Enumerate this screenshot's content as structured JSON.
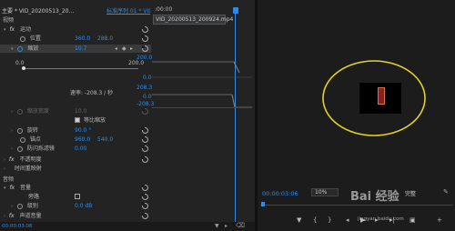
{
  "header": {
    "source_tab": "主要 * VID_20200513_20…",
    "sequence_tab": "标准序列 01 * VID_2…",
    "ruler_time": ":00:00"
  },
  "sections": {
    "video": "视频",
    "motion": "运动",
    "opacity": "不透明度",
    "time_remap": "时间重映射",
    "audio": "音频",
    "volume": "音量",
    "channel_volume": "声道音量"
  },
  "motion": {
    "position_label": "位置",
    "position_x": "360.0",
    "position_y": "288.0",
    "scale_label": "缩放",
    "scale_value": "10.7",
    "slider_min": "0.0",
    "slider_max": "200.0",
    "speed_label": "速率: -208.3 / 秒",
    "uniform_label": "缩放宽度",
    "uniform_value": "10.0",
    "uniform_scale_label": "等比缩放",
    "rotation_label": "旋转",
    "rotation_value": "90.0 °",
    "anchor_label": "锚点",
    "anchor_x": "960.0",
    "anchor_y": "540.0",
    "antiflicker_label": "防闪烁滤镜",
    "antiflicker_value": "0.00"
  },
  "graph": {
    "val_top": "200.0",
    "val_zero1": "0.0",
    "val_mid": "208.3",
    "val_zero2": "0.0",
    "val_neg": "-208.3"
  },
  "audio": {
    "bypass_label": "旁路",
    "level_label": "级别",
    "level_value": "0.0 dB"
  },
  "timeline": {
    "clip_name": "VID_20200513_200924.mp4"
  },
  "status": {
    "left_timecode": "00:00:03:06"
  },
  "program": {
    "timecode": "00:00:03:06",
    "zoom": "10%",
    "quality": "完整"
  },
  "watermark": {
    "site": "jingyan.baidu.com",
    "brand": "Bai 经验"
  },
  "colors": {
    "accent": "#2d8ceb",
    "highlight_ellipse": "#e6d21e"
  }
}
